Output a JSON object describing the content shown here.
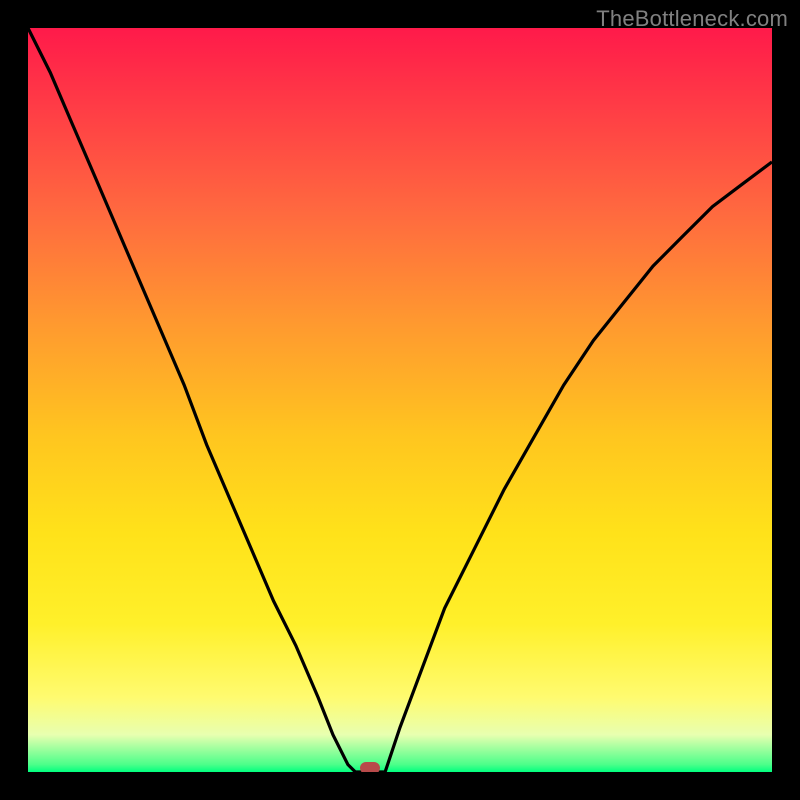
{
  "watermark": "TheBottleneck.com",
  "chart_data": {
    "type": "line",
    "title": "",
    "xlabel": "",
    "ylabel": "",
    "xlim": [
      0,
      1
    ],
    "ylim": [
      0,
      1
    ],
    "series": [
      {
        "name": "curve-left",
        "x": [
          0.0,
          0.03,
          0.06,
          0.09,
          0.12,
          0.15,
          0.18,
          0.21,
          0.24,
          0.27,
          0.3,
          0.33,
          0.36,
          0.39,
          0.41,
          0.43,
          0.44
        ],
        "y": [
          1.0,
          0.94,
          0.87,
          0.8,
          0.73,
          0.66,
          0.59,
          0.52,
          0.44,
          0.37,
          0.3,
          0.23,
          0.17,
          0.1,
          0.05,
          0.01,
          0.0
        ]
      },
      {
        "name": "curve-right",
        "x": [
          0.48,
          0.5,
          0.53,
          0.56,
          0.6,
          0.64,
          0.68,
          0.72,
          0.76,
          0.8,
          0.84,
          0.88,
          0.92,
          0.96,
          1.0
        ],
        "y": [
          0.0,
          0.06,
          0.14,
          0.22,
          0.3,
          0.38,
          0.45,
          0.52,
          0.58,
          0.63,
          0.68,
          0.72,
          0.76,
          0.79,
          0.82
        ]
      },
      {
        "name": "floor",
        "x": [
          0.44,
          0.48
        ],
        "y": [
          0.0,
          0.0
        ]
      }
    ],
    "marker": {
      "x": 0.46,
      "y": 0.0
    },
    "gradient_stops": [
      {
        "pos": 0.0,
        "color": "#ff1a4a"
      },
      {
        "pos": 0.1,
        "color": "#ff3a46"
      },
      {
        "pos": 0.25,
        "color": "#ff6a3f"
      },
      {
        "pos": 0.4,
        "color": "#ff9a2f"
      },
      {
        "pos": 0.55,
        "color": "#ffc61f"
      },
      {
        "pos": 0.68,
        "color": "#ffe21a"
      },
      {
        "pos": 0.8,
        "color": "#fff02a"
      },
      {
        "pos": 0.9,
        "color": "#fffb70"
      },
      {
        "pos": 0.95,
        "color": "#e8ffb0"
      },
      {
        "pos": 0.99,
        "color": "#4cff8a"
      },
      {
        "pos": 1.0,
        "color": "#00ff7f"
      }
    ]
  }
}
